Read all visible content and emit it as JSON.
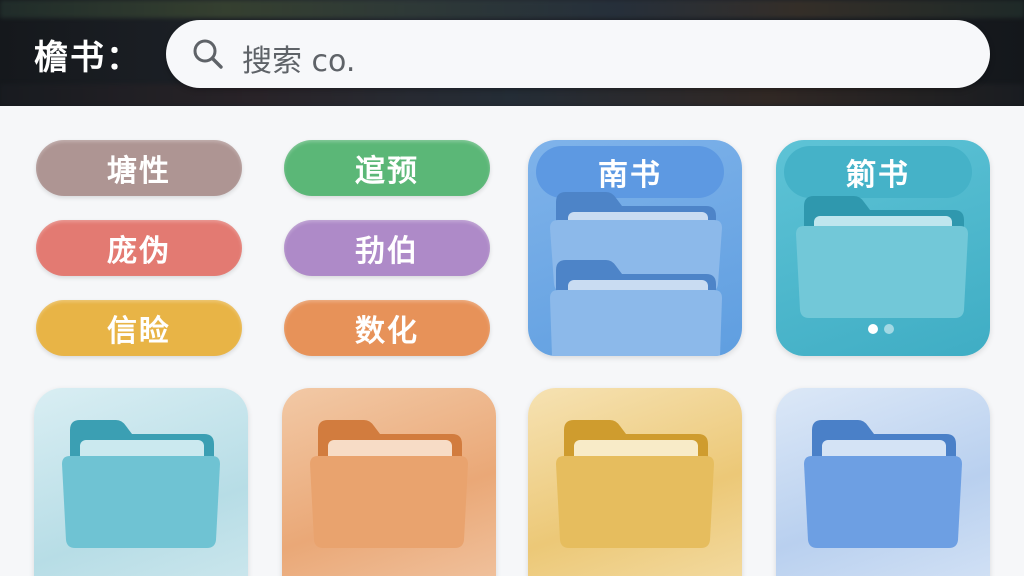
{
  "header": {
    "title": "檐书：",
    "search": {
      "icon": "search-icon",
      "text": "搜索 co."
    }
  },
  "pills": [
    {
      "label": "塘性",
      "color": "#ae9593"
    },
    {
      "label": "逭预",
      "color": "#5bb777"
    },
    {
      "label": "庞伪",
      "color": "#e37a72"
    },
    {
      "label": "劧伯",
      "color": "#ae8ac8"
    },
    {
      "label": "信睑",
      "color": "#e8b446"
    },
    {
      "label": "数化",
      "color": "#e79259"
    }
  ],
  "tiles": {
    "nanshu": {
      "label": "南书",
      "color": "#6ea8e4",
      "icon": "folder-icon"
    },
    "bangshu": {
      "label": "箣书",
      "color": "#4bb7cc",
      "icon": "folder-icon",
      "page_dots": 2,
      "active_dot": 1
    },
    "teal": {
      "color": "#6fc3d3",
      "icon": "folder-icon"
    },
    "orange": {
      "color": "#e9a36e",
      "icon": "folder-icon"
    },
    "yellow": {
      "color": "#e6bd5e",
      "icon": "folder-icon"
    },
    "blue": {
      "color": "#6d9fe3",
      "icon": "folder-icon"
    }
  }
}
